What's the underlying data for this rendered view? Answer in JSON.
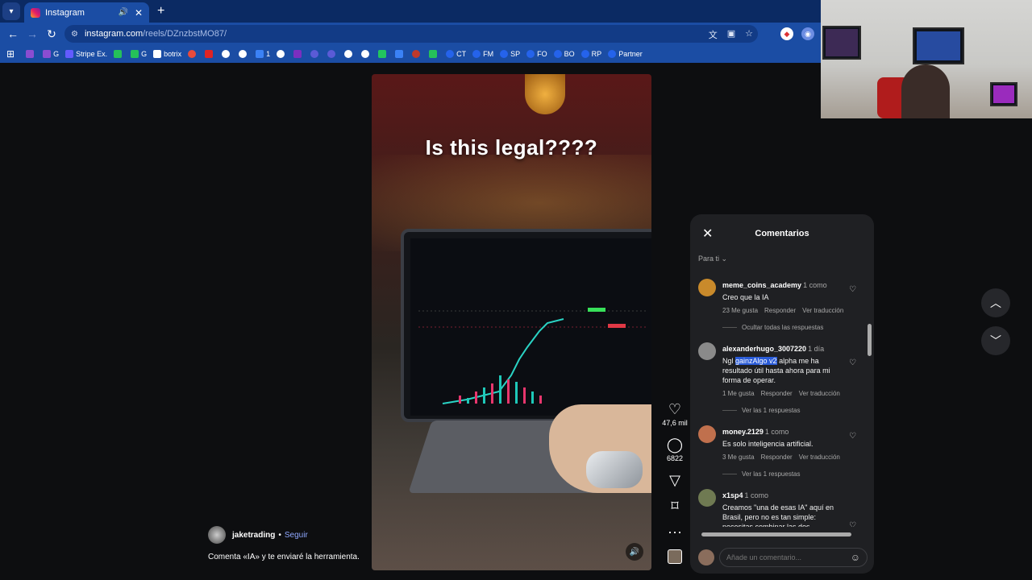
{
  "browser": {
    "tab_title": "Instagram",
    "url_host": "instagram.com",
    "url_path": "/reels/DZnzbstMO87/",
    "bookmarks": [
      {
        "label": "G",
        "color": "#8b4dd1"
      },
      {
        "label": "Stripe Ex.",
        "color": "#635bff"
      },
      {
        "label": "G",
        "color": "#25c05a"
      },
      {
        "label": "botrix",
        "color": "#ffffff"
      },
      {
        "label": "",
        "color": "#e94b3c"
      },
      {
        "label": "",
        "color": "#e02424"
      },
      {
        "label": "",
        "color": "#ffffff"
      },
      {
        "label": "1",
        "color": "#3b82f6"
      },
      {
        "label": "",
        "color": "#ffffff"
      },
      {
        "label": "",
        "color": "#7b2fbf"
      },
      {
        "label": "",
        "color": "#5b5bd6"
      },
      {
        "label": "",
        "color": "#ffffff"
      },
      {
        "label": "",
        "color": "#22c55e"
      },
      {
        "label": "",
        "color": "#3b82f6"
      },
      {
        "label": "",
        "color": "#c0392b"
      },
      {
        "label": "",
        "color": "#25c05a"
      },
      {
        "label": "CT",
        "color": "#2563eb"
      },
      {
        "label": "FM",
        "color": "#2563eb"
      },
      {
        "label": "SP",
        "color": "#2563eb"
      },
      {
        "label": "FO",
        "color": "#2563eb"
      },
      {
        "label": "BO",
        "color": "#2563eb"
      },
      {
        "label": "RP",
        "color": "#2563eb"
      },
      {
        "label": "Partner",
        "color": "#2563eb"
      }
    ]
  },
  "reel": {
    "caption": "Is this legal????",
    "author": "jaketrading",
    "follow_label": "Seguir",
    "description": "Comenta «IA» y te enviaré la herramienta.",
    "likes": "47,6 mil",
    "comments_count": "6822"
  },
  "comments_panel": {
    "title": "Comentarios",
    "sort_label": "Para ti",
    "input_placeholder": "Añade un comentario...",
    "items": [
      {
        "user": "meme_coins_academy",
        "time": "1 como",
        "text": "Creo que la IA",
        "likes": "23 Me gusta",
        "reply": "Responder",
        "translate": "Ver traducción",
        "replies": "Ocultar todas las respuestas",
        "avatar_color": "#c98a2b"
      },
      {
        "user": "alexanderhugo_3007220",
        "time": "1 día",
        "text_pre": "Ngl ",
        "text_hl": "gainzAlgo v2",
        "text_post": " alpha me ha resultado útil hasta ahora para mi forma de operar.",
        "likes": "1 Me gusta",
        "reply": "Responder",
        "translate": "Ver traducción",
        "replies": "Ver las 1 respuestas",
        "avatar_color": "#8a8a8a"
      },
      {
        "user": "money.2129",
        "time": "1 como",
        "text": "Es solo inteligencia artificial.",
        "likes": "3 Me gusta",
        "reply": "Responder",
        "translate": "Ver traducción",
        "replies": "Ver las 1 respuestas",
        "avatar_color": "#c0704d"
      },
      {
        "user": "x1sp4",
        "time": "1 como",
        "text": "Creamos \"una de esas IA\" aquí en Brasil, pero no es tan simple: necesitas combinar las dos herramientas (Humano + Análisis Cuantitativo) = enlace en mi",
        "avatar_color": "#6f7a52"
      }
    ]
  }
}
